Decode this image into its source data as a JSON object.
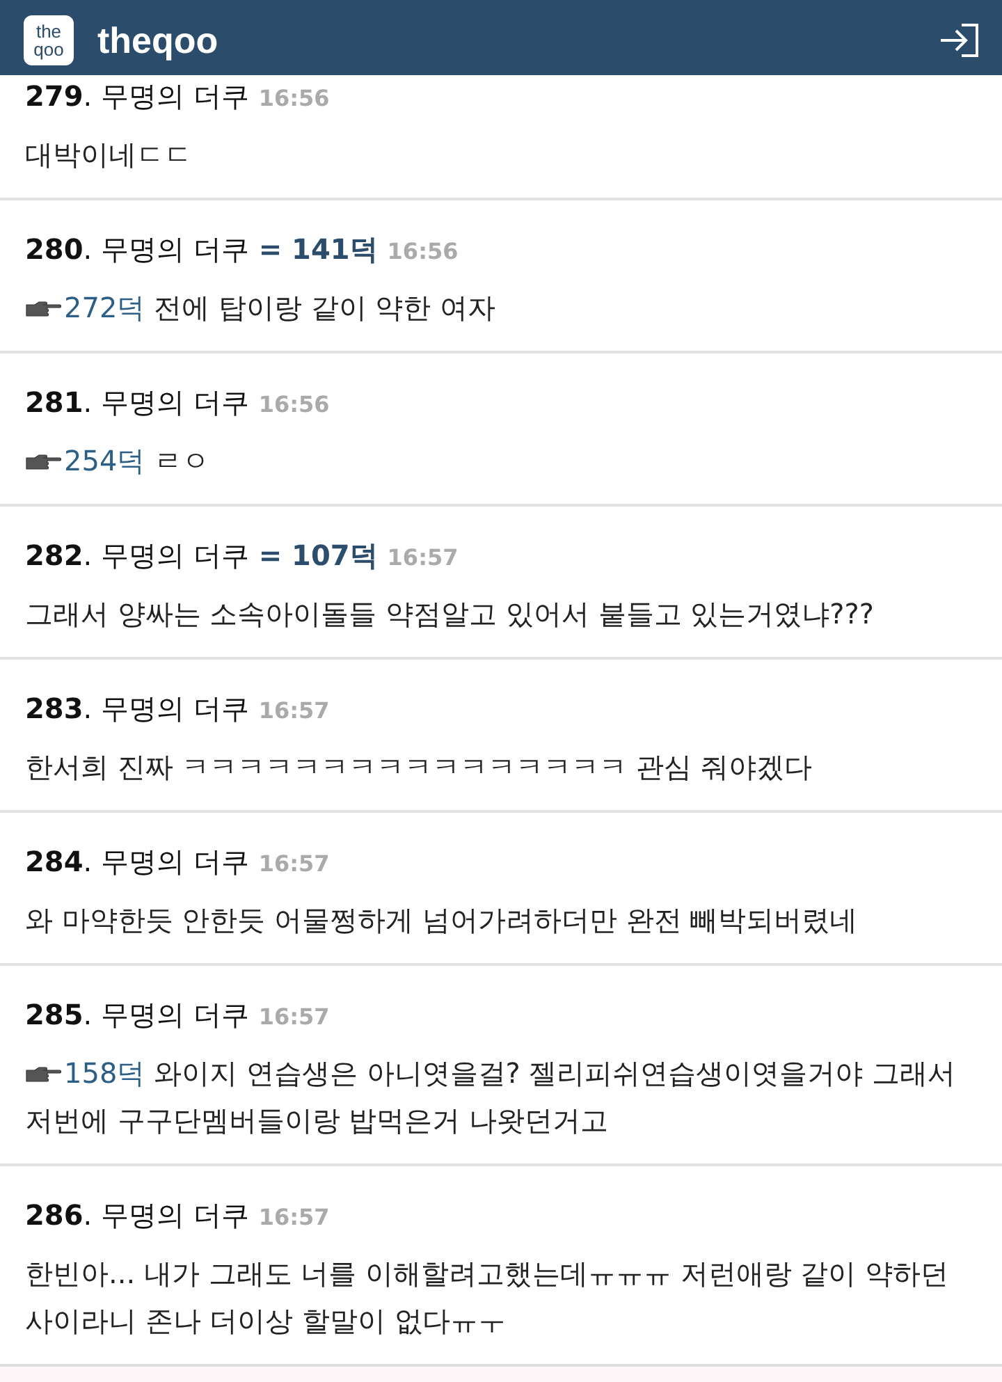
{
  "header": {
    "title": "theqoo",
    "logo": "the qoo"
  },
  "comments": [
    {
      "number": "**279**.",
      "author": "무명의 더쿠",
      "time": "16:56",
      "text": "대박이네ㄷㄷ"
    },
    {
      "number": "**280**.",
      "author": "무명의 더쿠",
      "ref": "= 141덕",
      "time": "16:56",
      "reply_to": "272덕",
      "text": "전에 탑이랑 같이 약한 여자"
    },
    {
      "number": "**281**.",
      "author": "무명의 더쿠",
      "time": "16:56",
      "reply_to": "254덕",
      "text": "ㄹㅇ"
    },
    {
      "number": "**282**.",
      "author": "무명의 더쿠",
      "ref": "= 107덕",
      "time": "16:57",
      "text": "그래서 양싸는 소속아이돌들 약점알고 있어서 붙들고 있는거였냐???"
    },
    {
      "number": "**283**.",
      "author": "무명의 더쿠",
      "time": "16:57",
      "text": "한서희 진짜 ㅋㅋㅋㅋㅋㅋㅋㅋㅋㅋㅋㅋㅋㅋㅋㅋ 관심 줘야겠다"
    },
    {
      "number": "**284**.",
      "author": "무명의 더쿠",
      "time": "16:57",
      "text": "와 마약한듯 안한듯 어물쩡하게 넘어가려하더만 완전 빼박되버렸네"
    },
    {
      "number": "**285**.",
      "author": "무명의 더쿠",
      "time": "16:57",
      "reply_to": "158덕",
      "text": "와이지 연습생은 아니엿을걸? 젤리피쉬연습생이엿을거야 그래서 저번에 구구단멤버들이랑 밥먹은거 나왓던거고"
    },
    {
      "number": "**286**.",
      "author": "무명의 더쿠",
      "time": "16:57",
      "text": "한빈아... 내가 그래도 너를 이해할려고했는데ㅠㅠㅠ 저런애랑 같이 약하던 사이라니 존나 더이상 할말이 없다ㅠㅜ"
    }
  ]
}
